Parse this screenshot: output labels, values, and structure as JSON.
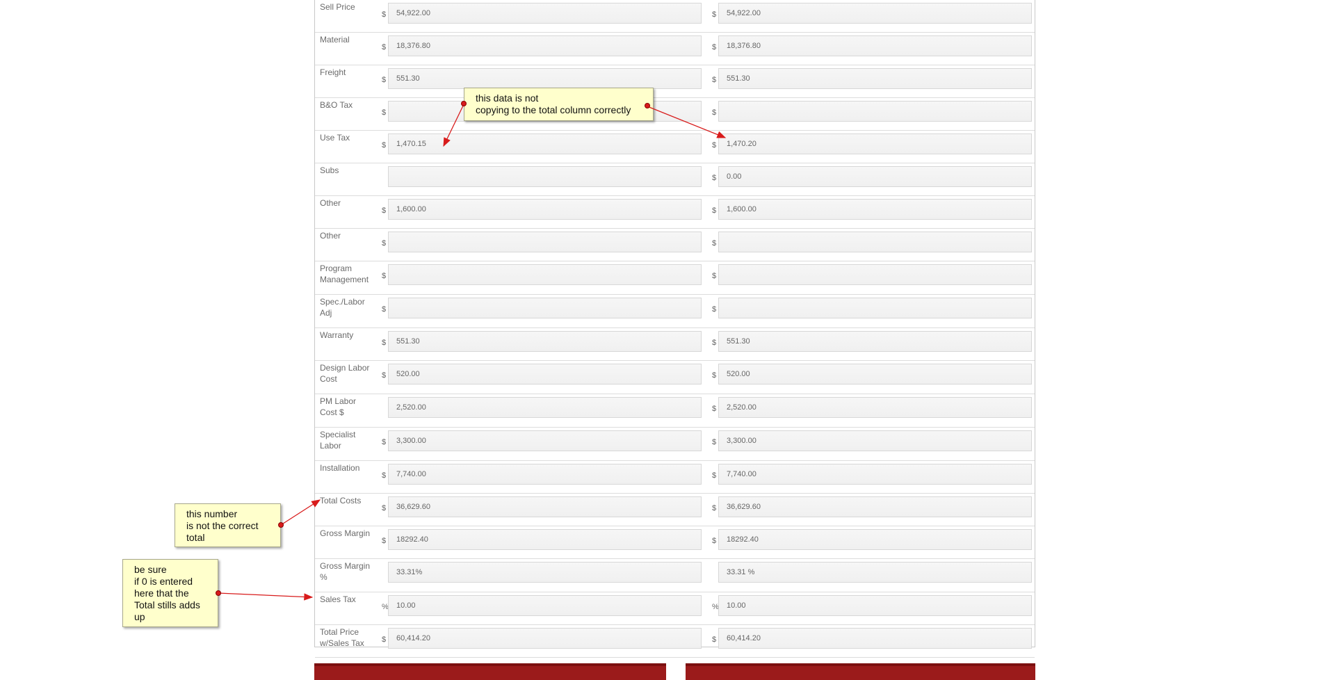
{
  "rows": [
    {
      "label": "Sell Price",
      "prefix_a": "$",
      "value_a": "54,922.00",
      "prefix_b": "$",
      "value_b": "54,922.00"
    },
    {
      "label": "Material",
      "prefix_a": "$",
      "value_a": "18,376.80",
      "prefix_b": "$",
      "value_b": "18,376.80"
    },
    {
      "label": "Freight",
      "prefix_a": "$",
      "value_a": "551.30",
      "prefix_b": "$",
      "value_b": "551.30"
    },
    {
      "label": "B&O Tax",
      "prefix_a": "$",
      "value_a": "",
      "prefix_b": "$",
      "value_b": ""
    },
    {
      "label": "Use Tax",
      "prefix_a": "$",
      "value_a": "1,470.15",
      "prefix_b": "$",
      "value_b": "1,470.20"
    },
    {
      "label": "Subs",
      "prefix_a": "",
      "value_a": "",
      "prefix_b": "$",
      "value_b": "0.00"
    },
    {
      "label": "Other",
      "prefix_a": "$",
      "value_a": "1,600.00",
      "prefix_b": "$",
      "value_b": "1,600.00"
    },
    {
      "label": "Other",
      "prefix_a": "$",
      "value_a": "",
      "prefix_b": "$",
      "value_b": ""
    },
    {
      "label": "Program Management",
      "prefix_a": "$",
      "value_a": "",
      "prefix_b": "$",
      "value_b": ""
    },
    {
      "label": "Spec./Labor Adj",
      "prefix_a": "$",
      "value_a": "",
      "prefix_b": "$",
      "value_b": ""
    },
    {
      "label": "Warranty",
      "prefix_a": "$",
      "value_a": "551.30",
      "prefix_b": "$",
      "value_b": "551.30"
    },
    {
      "label": "Design Labor Cost",
      "prefix_a": "$",
      "value_a": "520.00",
      "prefix_b": "$",
      "value_b": "520.00"
    },
    {
      "label": "PM Labor Cost $",
      "prefix_a": "",
      "value_a": "2,520.00",
      "prefix_b": "$",
      "value_b": "2,520.00"
    },
    {
      "label": "Specialist Labor",
      "prefix_a": "$",
      "value_a": "3,300.00",
      "prefix_b": "$",
      "value_b": "3,300.00"
    },
    {
      "label": "Installation",
      "prefix_a": "$",
      "value_a": "7,740.00",
      "prefix_b": "$",
      "value_b": "7,740.00"
    },
    {
      "label": "Total Costs",
      "prefix_a": "$",
      "value_a": "36,629.60",
      "prefix_b": "$",
      "value_b": "36,629.60"
    },
    {
      "label": "Gross Margin",
      "prefix_a": "$",
      "value_a": "18292.40",
      "prefix_b": "$",
      "value_b": "18292.40"
    },
    {
      "label": "Gross Margin %",
      "prefix_a": "",
      "value_a": "33.31%",
      "prefix_b": "",
      "value_b": "33.31 %"
    },
    {
      "label": "Sales Tax",
      "prefix_a": "%",
      "value_a": "10.00",
      "prefix_b": "%",
      "value_b": "10.00"
    },
    {
      "label": "Total Price w/Sales Tax",
      "prefix_a": "$",
      "value_a": "60,414.20",
      "prefix_b": "$",
      "value_b": "60,414.20"
    }
  ],
  "annotations": {
    "copy_note": "this data is not\ncopying to the total column correctly",
    "total_note": "this number\nis not the correct\ntotal",
    "sales_tax_note": "be sure\nif 0 is entered\nhere that the\nTotal stills adds\nup"
  },
  "colors": {
    "note_bg": "#ffffcc",
    "arrow": "#d81b1b",
    "button": "#9b1b1b"
  }
}
